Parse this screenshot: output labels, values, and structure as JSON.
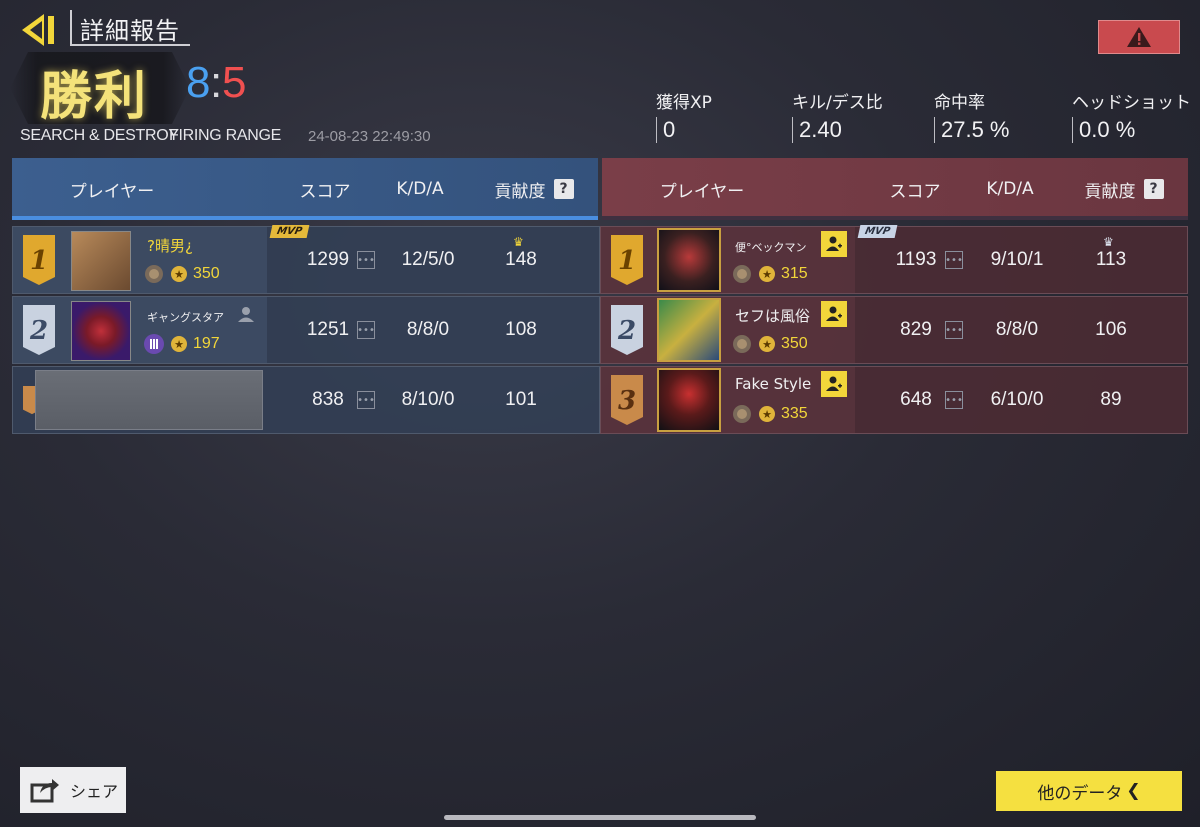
{
  "header": {
    "title": "詳細報告",
    "result": "勝利",
    "score_blue": "8",
    "score_sep": ":",
    "score_red": "5",
    "mode": "SEARCH & DESTROY",
    "map": "FIRING RANGE",
    "datetime": "24-08-23 22:49:30"
  },
  "stats": [
    {
      "label": "獲得XP",
      "value": "0"
    },
    {
      "label": "キル/デス比",
      "value": "2.40"
    },
    {
      "label": "命中率",
      "value": "27.5 %"
    },
    {
      "label": "ヘッドショット",
      "value": "0.0 %"
    }
  ],
  "columns": {
    "player": "プレイヤー",
    "score": "スコア",
    "kda": "K/D/A",
    "contribution": "貢献度",
    "help": "?"
  },
  "blue_team": [
    {
      "rank": "1",
      "name": "?晴男¿",
      "level": "350",
      "score": "1299",
      "kda": "12/5/0",
      "contribution": "148",
      "mvp": "MVP"
    },
    {
      "rank": "2",
      "name": "ギャングスタア",
      "level": "197",
      "score": "1251",
      "kda": "8/8/0",
      "contribution": "108"
    },
    {
      "rank": "",
      "name": "",
      "level": "",
      "score": "838",
      "kda": "8/10/0",
      "contribution": "101"
    }
  ],
  "red_team": [
    {
      "rank": "1",
      "name": "便°ベックマン",
      "level": "315",
      "score": "1193",
      "kda": "9/10/1",
      "contribution": "113",
      "mvp": "MVP"
    },
    {
      "rank": "2",
      "name": "セフは風俗",
      "level": "350",
      "score": "829",
      "kda": "8/8/0",
      "contribution": "106"
    },
    {
      "rank": "3",
      "name": "Fake Style",
      "level": "335",
      "score": "648",
      "kda": "6/10/0",
      "contribution": "89"
    }
  ],
  "footer": {
    "share": "シェア",
    "other": "他のデータ"
  },
  "colors": {
    "blue_score": "#4aa0f0",
    "red_score": "#f05050",
    "victory": "#f4e27a",
    "accent_yellow": "#f5e040"
  }
}
